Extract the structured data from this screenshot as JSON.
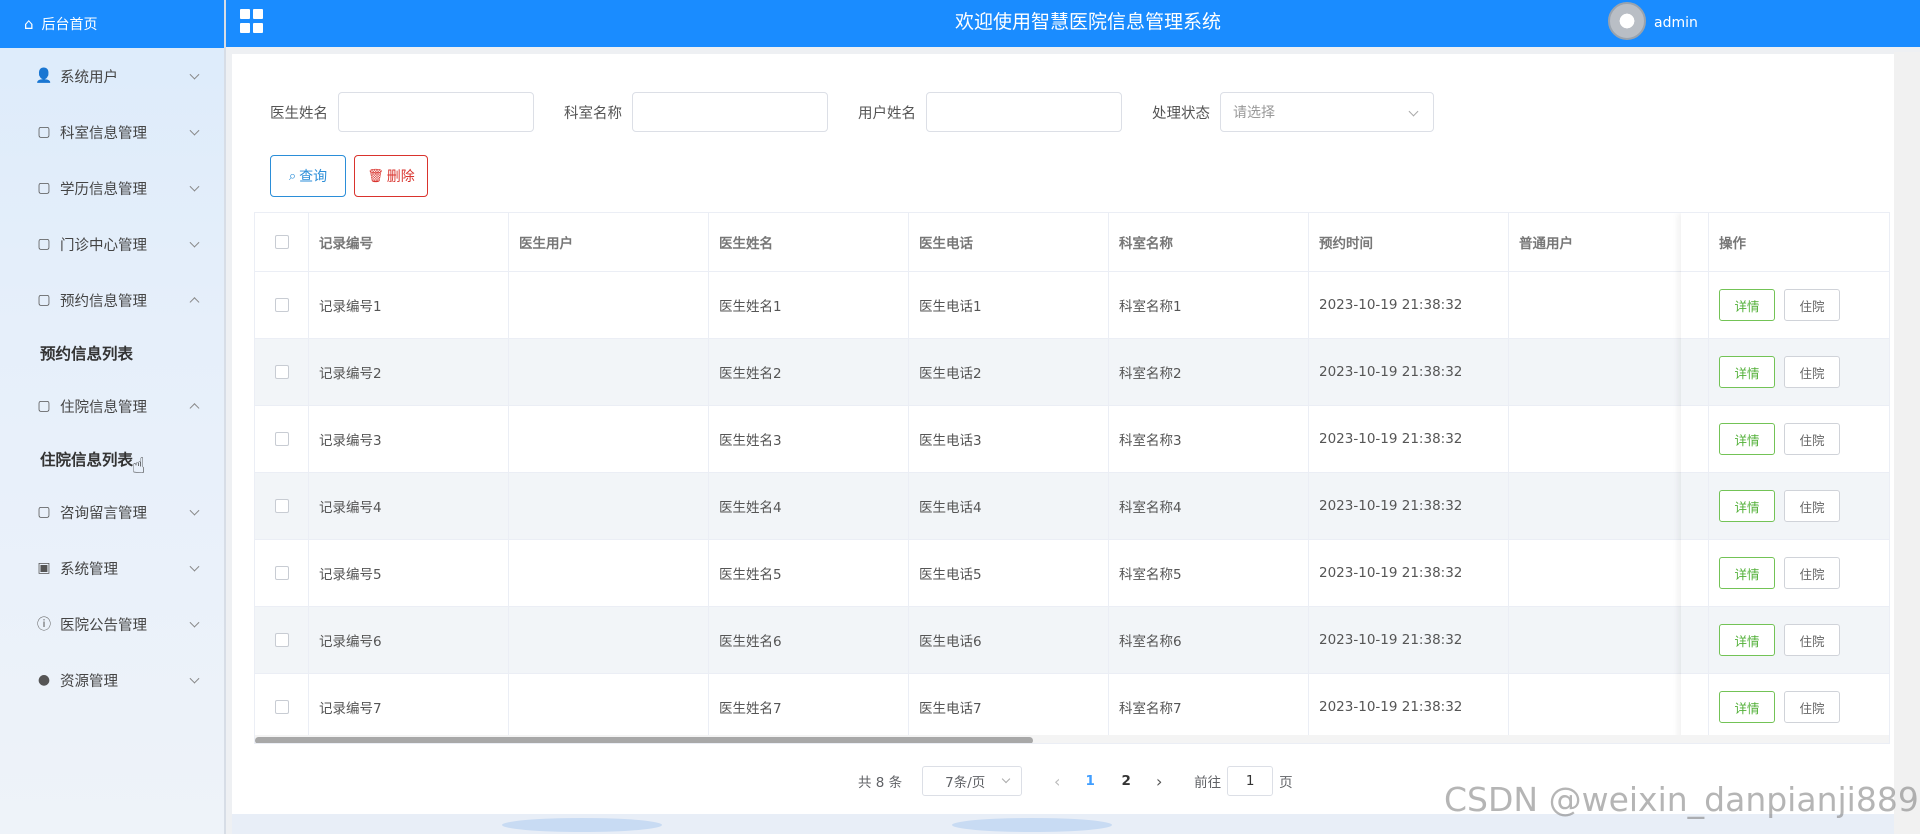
{
  "header": {
    "title": "欢迎使用智慧医院信息管理系统",
    "username": "admin"
  },
  "sidebar": {
    "home": "后台首页",
    "items": [
      {
        "label": "系统用户",
        "icon": "user-icon"
      },
      {
        "label": "科室信息管理",
        "icon": "folder-icon"
      },
      {
        "label": "学历信息管理",
        "icon": "folder-icon"
      },
      {
        "label": "门诊中心管理",
        "icon": "folder-icon"
      },
      {
        "label": "预约信息管理",
        "icon": "folder-icon",
        "expanded": true,
        "sub": "预约信息列表"
      },
      {
        "label": "住院信息管理",
        "icon": "folder-icon",
        "expanded": true,
        "sub": "住院信息列表"
      },
      {
        "label": "咨询留言管理",
        "icon": "folder-icon"
      },
      {
        "label": "系统管理",
        "icon": "image-icon"
      },
      {
        "label": "医院公告管理",
        "icon": "info-icon"
      },
      {
        "label": "资源管理",
        "icon": "bulb-icon"
      }
    ]
  },
  "search": {
    "doctor_name_label": "医生姓名",
    "dept_name_label": "科室名称",
    "user_name_label": "用户姓名",
    "status_label": "处理状态",
    "status_placeholder": "请选择",
    "query_btn": "查询",
    "delete_btn": "删除"
  },
  "table": {
    "columns": [
      "记录编号",
      "医生用户",
      "医生姓名",
      "医生电话",
      "科室名称",
      "预约时间",
      "普通用户",
      "操作"
    ],
    "rows": [
      {
        "id": "记录编号1",
        "doc_user": "",
        "doc_name": "医生姓名1",
        "doc_phone": "医生电话1",
        "dept": "科室名称1",
        "time": "2023-10-19 21:38:32",
        "user": ""
      },
      {
        "id": "记录编号2",
        "doc_user": "",
        "doc_name": "医生姓名2",
        "doc_phone": "医生电话2",
        "dept": "科室名称2",
        "time": "2023-10-19 21:38:32",
        "user": ""
      },
      {
        "id": "记录编号3",
        "doc_user": "",
        "doc_name": "医生姓名3",
        "doc_phone": "医生电话3",
        "dept": "科室名称3",
        "time": "2023-10-19 21:38:32",
        "user": ""
      },
      {
        "id": "记录编号4",
        "doc_user": "",
        "doc_name": "医生姓名4",
        "doc_phone": "医生电话4",
        "dept": "科室名称4",
        "time": "2023-10-19 21:38:32",
        "user": ""
      },
      {
        "id": "记录编号5",
        "doc_user": "",
        "doc_name": "医生姓名5",
        "doc_phone": "医生电话5",
        "dept": "科室名称5",
        "time": "2023-10-19 21:38:32",
        "user": ""
      },
      {
        "id": "记录编号6",
        "doc_user": "",
        "doc_name": "医生姓名6",
        "doc_phone": "医生电话6",
        "dept": "科室名称6",
        "time": "2023-10-19 21:38:32",
        "user": ""
      },
      {
        "id": "记录编号7",
        "doc_user": "",
        "doc_name": "医生姓名7",
        "doc_phone": "医生电话7",
        "dept": "科室名称7",
        "time": "2023-10-19 21:38:32",
        "user": ""
      }
    ],
    "detail_btn": "详情",
    "hospital_btn": "住院"
  },
  "pagination": {
    "total": "共 8 条",
    "page_size": "7条/页",
    "pages": [
      "1",
      "2"
    ],
    "current": "1",
    "goto_label": "前往",
    "goto_value": "1",
    "page_suffix": "页"
  },
  "watermark": "CSDN @weixin_danpianji889",
  "colors": {
    "primary": "#1a8cff",
    "success": "#52b038",
    "danger": "#d9332d"
  }
}
